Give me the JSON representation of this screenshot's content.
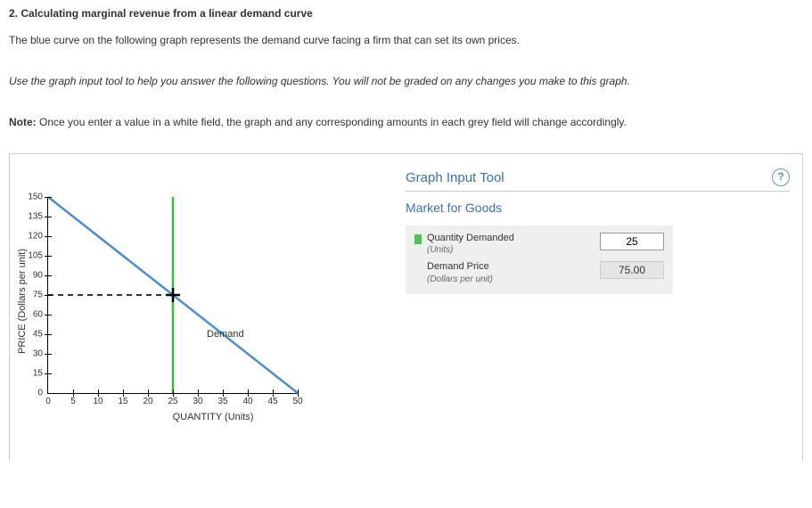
{
  "question": {
    "number": "2.",
    "title": "Calculating marginal revenue from a linear demand curve",
    "intro": "The blue curve on the following graph represents the demand curve facing a firm that can set its own prices.",
    "instructions": "Use the graph input tool to help you answer the following questions. You will not be graded on any changes you make to this graph.",
    "note_label": "Note:",
    "note_text": " Once you enter a value in a white field, the graph and any corresponding amounts in each grey field will change accordingly."
  },
  "graph": {
    "y_label": "PRICE (Dollars per unit)",
    "x_label": "QUANTITY (Units)",
    "demand_label": "Demand",
    "y_ticks": [
      "0",
      "15",
      "30",
      "45",
      "60",
      "75",
      "90",
      "105",
      "120",
      "135",
      "150"
    ],
    "x_ticks": [
      "0",
      "5",
      "10",
      "15",
      "20",
      "25",
      "30",
      "35",
      "40",
      "45",
      "50"
    ]
  },
  "tool": {
    "title": "Graph Input Tool",
    "subheader": "Market for Goods",
    "help": "?",
    "qty_label": "Quantity Demanded",
    "qty_units": "(Units)",
    "qty_value": "25",
    "price_label": "Demand Price",
    "price_units": "(Dollars per unit)",
    "price_value": "75.00"
  },
  "chart_data": {
    "type": "line",
    "title": "Market for Goods",
    "xlabel": "QUANTITY (Units)",
    "ylabel": "PRICE (Dollars per unit)",
    "xlim": [
      0,
      50
    ],
    "ylim": [
      0,
      150
    ],
    "series": [
      {
        "name": "Demand",
        "x": [
          0,
          50
        ],
        "y": [
          150,
          0
        ],
        "color": "#4a8fd4"
      }
    ],
    "marker_vertical_x": 25,
    "marker_horizontal_y": 75,
    "point": {
      "x": 25,
      "y": 75
    }
  }
}
